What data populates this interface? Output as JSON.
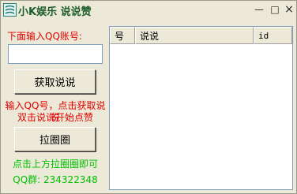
{
  "window": {
    "title": "小K娱乐 说说赞",
    "minimize_glyph": "—",
    "maximize_glyph": "□",
    "close_glyph": "×"
  },
  "left_panel": {
    "qq_label": "下面输入QQ账号:",
    "qq_input_value": "",
    "get_button_label": "获取说说",
    "hint_line1": "输入QQ号，点击获取说说",
    "hint_line2": "双击说说开始点赞",
    "pull_button_label": "拉圈圈",
    "pull_hint": "点击上方拉圈圈即可",
    "qq_group": "QQ群: 234322348"
  },
  "list": {
    "columns": [
      "号",
      "说说",
      "id"
    ],
    "rows": []
  },
  "colors": {
    "window_bg": "#ece9d8",
    "red_text": "#e00000",
    "green_text": "#00c000",
    "title_text": "#1a5d2a"
  },
  "icons": {
    "app": "app-logo-icon"
  }
}
